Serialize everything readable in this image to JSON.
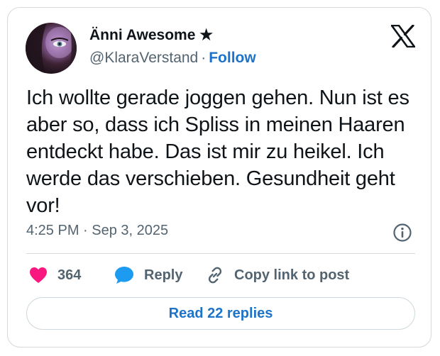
{
  "author": {
    "display_name": "Änni Awesome ★",
    "handle": "@KlaraVerstand",
    "separator": "·",
    "follow_label": "Follow",
    "avatar_icon": "profile-photo"
  },
  "platform": {
    "logo_icon": "x-logo"
  },
  "tweet": {
    "text": "Ich wollte gerade joggen gehen. Nun ist es aber so, dass ich Spliss in meinen Haaren entdeckt habe. Das ist mir zu heikel. Ich werde das verschieben. Gesundheit geht vor!",
    "timestamp": "4:25 PM · Sep 3, 2025",
    "info_icon": "info-icon"
  },
  "actions": {
    "like_count": "364",
    "reply_label": "Reply",
    "copy_label": "Copy link to post"
  },
  "read_replies_label": "Read 22 replies",
  "colors": {
    "link": "#1d73c9",
    "heart": "#f91880",
    "reply_bubble": "#1d9bf0",
    "text": "#0f1419",
    "muted": "#536471",
    "border": "#d5d9dc"
  }
}
